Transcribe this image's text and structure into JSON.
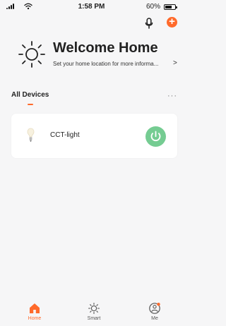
{
  "status_bar": {
    "time": "1:58 PM",
    "battery": "60%"
  },
  "header": {
    "title": "Welcome Home",
    "subtitle": "Set your home location for more informa...",
    "chevron": ">"
  },
  "section": {
    "tab_label": "All Devices",
    "more_label": "···"
  },
  "device": {
    "name": "CCT-light"
  },
  "nav": {
    "items": [
      {
        "label": "Home"
      },
      {
        "label": "Smart"
      },
      {
        "label": "Me"
      }
    ]
  },
  "colors": {
    "accent": "#ff6a2b",
    "power_on": "#75cc92",
    "background": "#f6f6f7"
  },
  "icons": {
    "signal": "signal-icon",
    "wifi": "wifi-icon",
    "battery": "battery-icon",
    "mic": "microphone-icon",
    "add": "plus-icon",
    "weather": "sun-icon",
    "bulb": "lightbulb-icon",
    "power": "power-icon",
    "home": "home-icon",
    "smart": "sun-icon",
    "me": "profile-icon"
  }
}
